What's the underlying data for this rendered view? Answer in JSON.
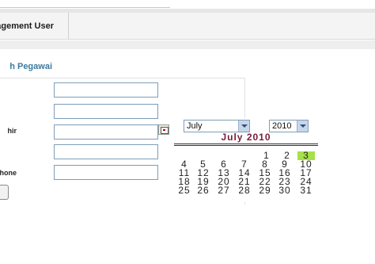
{
  "header": {
    "menu_label": "agement User"
  },
  "section": {
    "title": "h Pegawai"
  },
  "form": {
    "labels": [
      "hir",
      "hone"
    ]
  },
  "calendar": {
    "month_select": "July",
    "year_select": "2010",
    "title": "July 2010",
    "today": "3",
    "weeks": [
      [
        "",
        "",
        "",
        "",
        "1",
        "2",
        "3"
      ],
      [
        "4",
        "5",
        "6",
        "7",
        "8",
        "9",
        "10"
      ],
      [
        "11",
        "12",
        "13",
        "14",
        "15",
        "16",
        "17"
      ],
      [
        "18",
        "19",
        "20",
        "21",
        "22",
        "23",
        "24"
      ],
      [
        "25",
        "26",
        "27",
        "28",
        "29",
        "30",
        "31"
      ]
    ]
  },
  "colors": {
    "section_title": "#3b7a9e",
    "calendar_title": "#7a1a3a",
    "today_highlight": "#a6e04a",
    "input_border": "#7f9db9"
  },
  "icons": {
    "calendar_button": "calendar-icon",
    "dropdown": "chevron-down-icon"
  }
}
